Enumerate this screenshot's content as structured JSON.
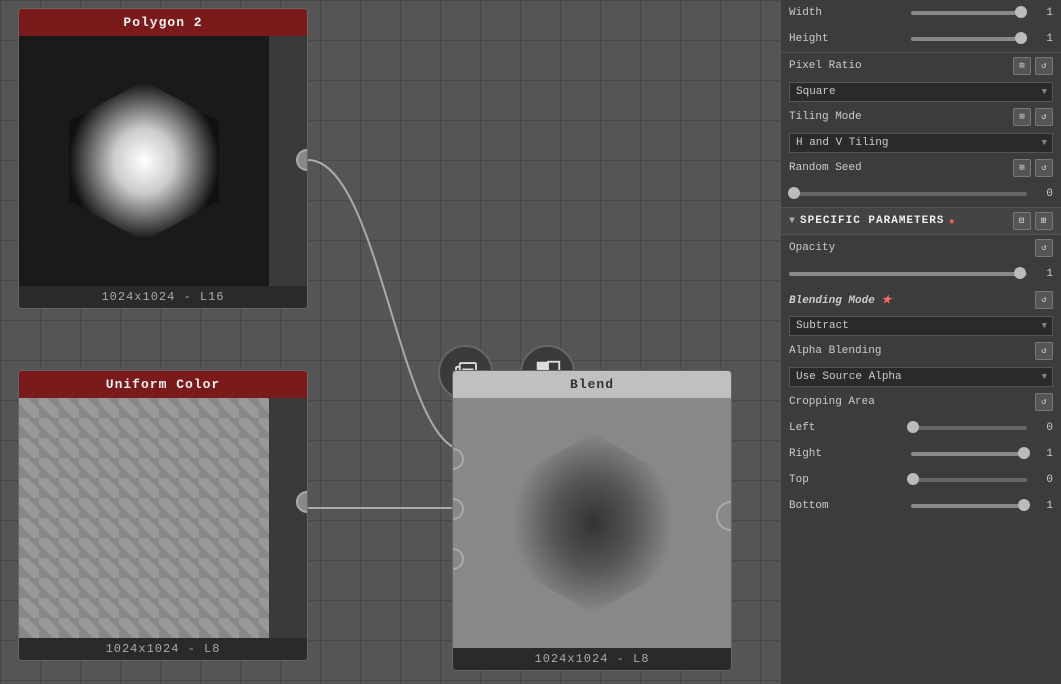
{
  "nodes": {
    "polygon2": {
      "title": "Polygon 2",
      "footer": "1024x1024 - L16"
    },
    "uniformColor": {
      "title": "Uniform Color",
      "footer": "1024x1024 - L8"
    },
    "blend": {
      "title": "Blend",
      "footer": "1024x1024 - L8"
    }
  },
  "panel": {
    "width_label": "Width",
    "width_value": "1",
    "height_label": "Height",
    "height_value": "1",
    "pixel_ratio_label": "Pixel Ratio",
    "pixel_ratio_option": "Square",
    "tiling_mode_label": "Tiling Mode",
    "tiling_mode_option": "H and V Tiling",
    "random_seed_label": "Random Seed",
    "random_seed_value": "0",
    "specific_params_label": "SPECIFIC PARAMETERS",
    "specific_params_star": "★",
    "opacity_label": "Opacity",
    "opacity_value": "1",
    "blending_mode_label": "Blending Mode",
    "blending_mode_star": "★",
    "blending_mode_option": "Subtract",
    "alpha_blending_label": "Alpha Blending",
    "alpha_blending_option": "Use Source Alpha",
    "cropping_area_label": "Cropping Area",
    "left_label": "Left",
    "left_value": "0",
    "right_label": "Right",
    "right_value": "1",
    "top_label": "Top",
    "top_value": "0",
    "bottom_label": "Bottom",
    "bottom_value": "1",
    "use_source_alpha_text": "Use Source Alpha"
  }
}
